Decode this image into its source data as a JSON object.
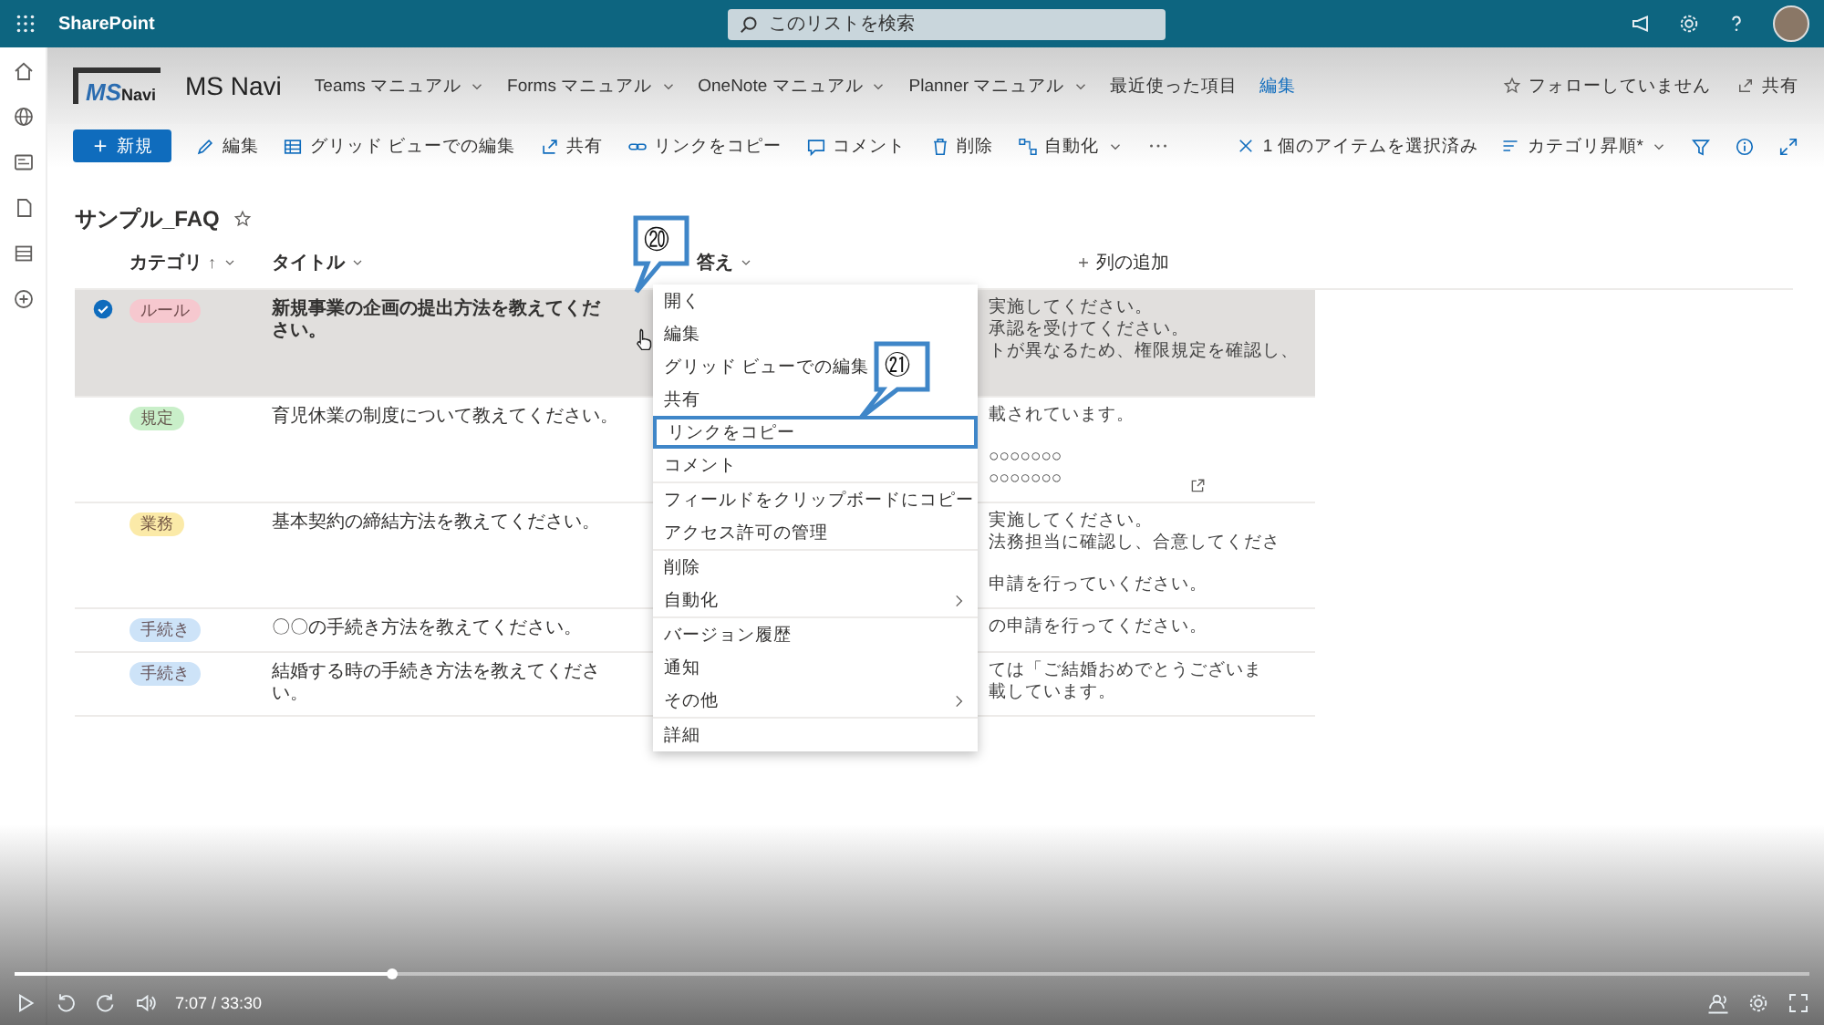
{
  "app_bar": {
    "brand": "SharePoint",
    "search": {
      "placeholder": "このリストを検索"
    }
  },
  "site": {
    "logo_main": "MS",
    "logo_sub": "Navi",
    "name": "MS Navi",
    "follow": "フォローしていません",
    "share": "共有",
    "nav": [
      {
        "label": "Teams マニュアル",
        "kind": "dropdown"
      },
      {
        "label": "Forms マニュアル",
        "kind": "dropdown"
      },
      {
        "label": "OneNote マニュアル",
        "kind": "dropdown"
      },
      {
        "label": "Planner マニュアル",
        "kind": "dropdown"
      },
      {
        "label": "最近使った項目",
        "kind": "plain"
      },
      {
        "label": "編集",
        "kind": "link"
      }
    ]
  },
  "command_bar": {
    "new": "新規",
    "selection": "1 個のアイテムを選択済み",
    "sort": "カテゴリ昇順*",
    "actions": [
      {
        "label": "編集",
        "dropdown": false
      },
      {
        "label": "グリッド ビューでの編集",
        "dropdown": false
      },
      {
        "label": "共有",
        "dropdown": false
      },
      {
        "label": "リンクをコピー",
        "dropdown": false
      },
      {
        "label": "コメント",
        "dropdown": false
      },
      {
        "label": "削除",
        "dropdown": false
      },
      {
        "label": "自動化",
        "dropdown": true
      }
    ]
  },
  "list": {
    "title": "サンプル_FAQ",
    "favorite": false,
    "add_column": "列の追加",
    "columns": [
      {
        "label": "カテゴリ",
        "sort_mark": "↑"
      },
      {
        "label": "タイトル"
      },
      {
        "label": "答え"
      }
    ],
    "rows": [
      {
        "selected": true,
        "category": "ルール",
        "color": "#f6c8cf",
        "title": "新規事業の企画の提出方法を教えてください。",
        "link_icon": false,
        "answer": [
          [
            "実施してください。",
            "承認を受けてください。",
            "トが異なるため、権限規定を確認し、"
          ]
        ]
      },
      {
        "selected": false,
        "category": "規定",
        "color": "#c9efc9",
        "title": "育児休業の制度について教えてください。",
        "link_icon": true,
        "answer": [
          [
            "載されています。"
          ],
          [
            "○○○○○○○",
            "○○○○○○○"
          ]
        ]
      },
      {
        "selected": false,
        "category": "業務",
        "color": "#fbeaa8",
        "title": "基本契約の締結方法を教えてください。",
        "link_icon": false,
        "answer": [
          [
            "実施してください。",
            "法務担当に確認し、合意してくださ"
          ],
          [
            "申請を行っていください。"
          ]
        ]
      },
      {
        "selected": false,
        "category": "手続き",
        "color": "#cde3f8",
        "title": "〇〇の手続き方法を教えてください。",
        "link_icon": false,
        "answer": [
          [
            "の申請を行ってください。"
          ]
        ]
      },
      {
        "selected": false,
        "category": "手続き",
        "color": "#cde3f8",
        "title": "結婚する時の手続き方法を教えてください。",
        "link_icon": false,
        "answer": [
          [
            "ては「ご結婚おめでとうございま",
            "載しています。"
          ]
        ]
      }
    ]
  },
  "context_menu": {
    "items": [
      {
        "label": "開く",
        "submenu": false,
        "separator_before": false,
        "highlighted": false
      },
      {
        "label": "編集",
        "submenu": false,
        "separator_before": false,
        "highlighted": false
      },
      {
        "label": "グリッド ビューでの編集",
        "submenu": false,
        "separator_before": false,
        "highlighted": false
      },
      {
        "label": "共有",
        "submenu": false,
        "separator_before": false,
        "highlighted": false
      },
      {
        "label": "リンクをコピー",
        "submenu": false,
        "separator_before": false,
        "highlighted": true
      },
      {
        "label": "コメント",
        "submenu": false,
        "separator_before": false,
        "highlighted": false
      },
      {
        "label": "フィールドをクリップボードにコピー",
        "submenu": false,
        "separator_before": true,
        "highlighted": false
      },
      {
        "label": "アクセス許可の管理",
        "submenu": false,
        "separator_before": false,
        "highlighted": false
      },
      {
        "label": "削除",
        "submenu": false,
        "separator_before": true,
        "highlighted": false
      },
      {
        "label": "自動化",
        "submenu": true,
        "separator_before": false,
        "highlighted": false
      },
      {
        "label": "バージョン履歴",
        "submenu": false,
        "separator_before": true,
        "highlighted": false
      },
      {
        "label": "通知",
        "submenu": false,
        "separator_before": false,
        "highlighted": false
      },
      {
        "label": "その他",
        "submenu": true,
        "separator_before": false,
        "highlighted": false
      },
      {
        "label": "詳細",
        "submenu": false,
        "separator_before": true,
        "highlighted": false
      }
    ]
  },
  "callouts": [
    {
      "number": "⑳"
    },
    {
      "number": "㉑"
    }
  ],
  "player": {
    "level": 0.21,
    "time": "7:07 / 33:30"
  }
}
